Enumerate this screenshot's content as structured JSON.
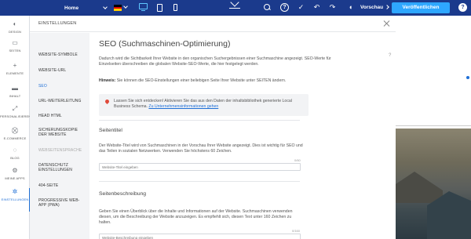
{
  "topbar": {
    "page_select": "Home",
    "vorschau": "Vorschau",
    "publish": "Veröffentlichen",
    "help": "?",
    "flag_colors": [
      "#000000",
      "#dd0000",
      "#ffce00"
    ],
    "icons": [
      "collapse-icon",
      "search-icon",
      "help-icon",
      "save-icon",
      "undo-icon",
      "redo-icon",
      "preview-icon"
    ]
  },
  "rail": {
    "items": [
      {
        "label": "DESIGN",
        "icon": "palette-icon",
        "glyph": "◐"
      },
      {
        "label": "SEITEN",
        "icon": "pages-icon",
        "glyph": "▭"
      },
      {
        "label": "ELEMENTE",
        "icon": "plus-icon",
        "glyph": "+"
      },
      {
        "label": "INHALT",
        "icon": "folder-icon",
        "glyph": "▬"
      },
      {
        "label": "PERSONALISIEREN",
        "icon": "personalize-icon",
        "glyph": "⤢"
      },
      {
        "label": "E-COMMERCE",
        "icon": "cart-icon",
        "glyph": "⛒"
      },
      {
        "label": "BLOG",
        "icon": "blog-icon",
        "glyph": "◌"
      },
      {
        "label": "MEINE APPS",
        "icon": "apps-icon",
        "glyph": "⚙"
      },
      {
        "label": "EINSTELLUNGEN",
        "icon": "settings-icon",
        "glyph": "✲"
      }
    ]
  },
  "panel": {
    "title": "EINSTELLUNGEN",
    "subnav": [
      "WEBSITE-SYMBOLE",
      "WEBSITE-URL",
      "SEO",
      "URL-WEITERLEITUNG",
      "HEAD HTML",
      "SICHERUNGSKOPIE DER WEBSITE",
      "WEBSEITENSPRACHE",
      "DATENSCHUTZ EINSTELLUNGEN",
      "404-SEITE",
      "PROGRESSIVE WEB-APP (PWA)"
    ],
    "help": "?",
    "heading": "SEO (Suchmaschinen-Optimierung)",
    "intro": "Dadurch wird die Sichtbarkeit Ihrer Website in den organischen Suchergebnissen einer Suchmaschine angezeigt. SEO-Werte für Einzelseiten überschreiben die globalen Website-SEO-Werte, die hier festgelegt werden.",
    "hint_label": "Hinweis:",
    "hint": " Sie können die SEO-Einstellungen einer beliebigen Seite Ihrer Website unter SEITEN ändern.",
    "notice_text": "Lassen Sie sich entdecken! Aktivieren Sie das aus den Daten der inhaltsbibliothek generierte Local Business Schema.",
    "notice_link": "Zu Unternehmensinformationen gehen",
    "title_section": {
      "heading": "Seitentitel",
      "description": "Der Website-Titel wird von Suchmaschinen in der Vorschau Ihrer Website angezeigt. Dies ist wichtig für SEO und das Teilen in sozialen Netzwerken. Verwenden Sie höchstens 60 Zeichen.",
      "counter": "0/60",
      "placeholder": "Website-Titel eingeben"
    },
    "desc_section": {
      "heading": "Seitenbeschreibung",
      "description": "Geben Sie einen Überblick über die Inhalte und Informationen auf der Website. Suchmaschinen verwenden diesen, um die Beschreibung der Website anzuzeigen. Es empfiehlt sich, diesen Text unter 160 Zeichen zu halten.",
      "counter": "0/160",
      "placeholder": "Website-Beschreibung eingeben"
    }
  }
}
